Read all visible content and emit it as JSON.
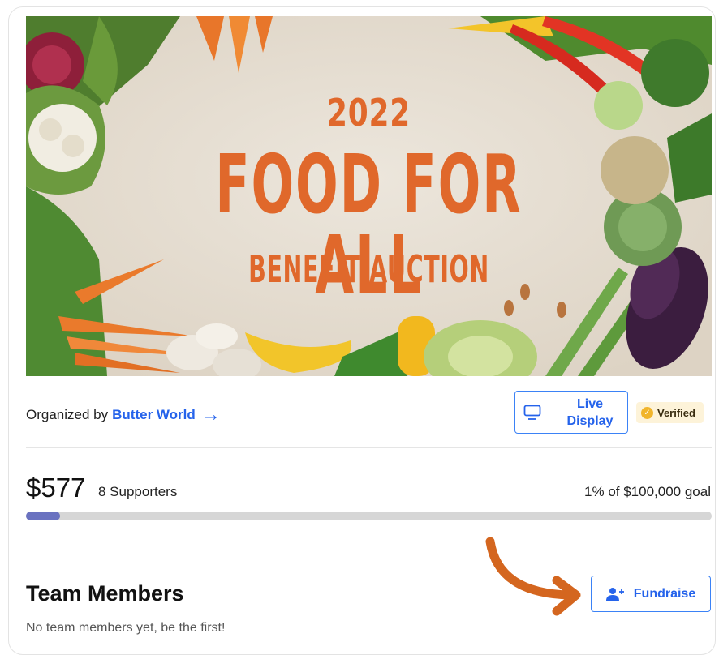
{
  "banner": {
    "year": "2022",
    "title": "FOOD FOR ALL",
    "subtitle": "BENEFIT AUCTION"
  },
  "organizer": {
    "prefix": "Organized by",
    "name": "Butter World"
  },
  "live_display": {
    "label": "Live\nDisplay"
  },
  "verified": {
    "label": "Verified"
  },
  "stats": {
    "raised": "$577",
    "supporters": "8 Supporters",
    "goal_text": "1% of $100,000 goal",
    "progress_fraction": 0.05
  },
  "team": {
    "title": "Team Members",
    "empty_text": "No team members yet, be the first!"
  },
  "fundraise": {
    "label": "Fundraise"
  },
  "colors": {
    "accent": "#2563eb",
    "banner_text": "#e0682b",
    "progress_fill": "#6a72c0",
    "annotation_arrow": "#d4661f"
  }
}
